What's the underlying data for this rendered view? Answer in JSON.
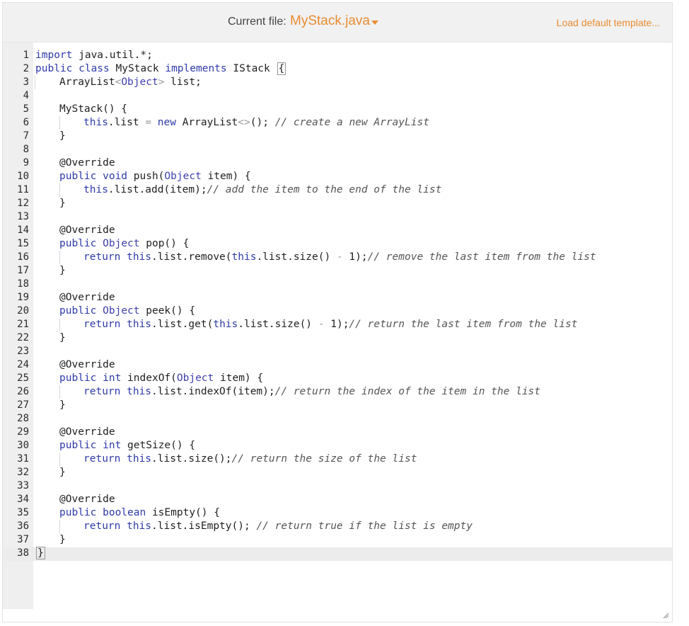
{
  "header": {
    "current_file_label": "Current file:",
    "file_name": "MyStack.java",
    "load_template": "Load default template..."
  },
  "editor": {
    "lines": [
      {
        "n": "1",
        "indent": 0,
        "segs": [
          [
            "kw",
            "import"
          ],
          [
            "",
            "java.util.*;"
          ]
        ]
      },
      {
        "n": "2",
        "indent": 0,
        "segs": [
          [
            "kw",
            "public class"
          ],
          [
            "",
            " MyStack "
          ],
          [
            "kw",
            "implements"
          ],
          [
            "",
            " IStack "
          ],
          [
            "br",
            "{"
          ]
        ]
      },
      {
        "n": "3",
        "indent": 1,
        "segs": [
          [
            "",
            "ArrayList"
          ],
          [
            "op",
            "<"
          ],
          [
            "ty",
            "Object"
          ],
          [
            "op",
            ">"
          ],
          [
            "",
            " list;"
          ]
        ]
      },
      {
        "n": "4",
        "indent": 0,
        "segs": []
      },
      {
        "n": "5",
        "indent": 1,
        "segs": [
          [
            "",
            "MyStack() {"
          ]
        ]
      },
      {
        "n": "6",
        "indent": 2,
        "segs": [
          [
            "kw",
            "this"
          ],
          [
            "",
            ".list "
          ],
          [
            "op",
            "="
          ],
          [
            "",
            " "
          ],
          [
            "kw",
            "new"
          ],
          [
            "",
            " ArrayList"
          ],
          [
            "op",
            "<>"
          ],
          [
            "",
            "(); "
          ],
          [
            "cm",
            "// create a new ArrayList"
          ]
        ]
      },
      {
        "n": "7",
        "indent": 1,
        "segs": [
          [
            "",
            "}"
          ]
        ]
      },
      {
        "n": "8",
        "indent": 0,
        "segs": []
      },
      {
        "n": "9",
        "indent": 1,
        "segs": [
          [
            "an",
            "@Override"
          ]
        ]
      },
      {
        "n": "10",
        "indent": 1,
        "segs": [
          [
            "kw",
            "public void"
          ],
          [
            "",
            " push("
          ],
          [
            "ty",
            "Object"
          ],
          [
            "",
            " item) {"
          ]
        ]
      },
      {
        "n": "11",
        "indent": 2,
        "segs": [
          [
            "kw",
            "this"
          ],
          [
            "",
            ".list.add(item);"
          ],
          [
            "cm",
            "// add the item to the end of the list"
          ]
        ]
      },
      {
        "n": "12",
        "indent": 1,
        "segs": [
          [
            "",
            "}"
          ]
        ]
      },
      {
        "n": "13",
        "indent": 0,
        "segs": []
      },
      {
        "n": "14",
        "indent": 1,
        "segs": [
          [
            "an",
            "@Override"
          ]
        ]
      },
      {
        "n": "15",
        "indent": 1,
        "segs": [
          [
            "kw",
            "public"
          ],
          [
            "",
            " "
          ],
          [
            "ty",
            "Object"
          ],
          [
            "",
            " pop() {"
          ]
        ]
      },
      {
        "n": "16",
        "indent": 2,
        "segs": [
          [
            "kw",
            "return this"
          ],
          [
            "",
            ".list.remove("
          ],
          [
            "kw",
            "this"
          ],
          [
            "",
            ".list.size() "
          ],
          [
            "op",
            "-"
          ],
          [
            "",
            " 1);"
          ],
          [
            "cm",
            "// remove the last item from the list"
          ]
        ]
      },
      {
        "n": "17",
        "indent": 1,
        "segs": [
          [
            "",
            "}"
          ]
        ]
      },
      {
        "n": "18",
        "indent": 0,
        "segs": []
      },
      {
        "n": "19",
        "indent": 1,
        "segs": [
          [
            "an",
            "@Override"
          ]
        ]
      },
      {
        "n": "20",
        "indent": 1,
        "segs": [
          [
            "kw",
            "public"
          ],
          [
            "",
            " "
          ],
          [
            "ty",
            "Object"
          ],
          [
            "",
            " peek() {"
          ]
        ]
      },
      {
        "n": "21",
        "indent": 2,
        "segs": [
          [
            "kw",
            "return this"
          ],
          [
            "",
            ".list.get("
          ],
          [
            "kw",
            "this"
          ],
          [
            "",
            ".list.size() "
          ],
          [
            "op",
            "-"
          ],
          [
            "",
            " 1);"
          ],
          [
            "cm",
            "// return the last item from the list"
          ]
        ]
      },
      {
        "n": "22",
        "indent": 1,
        "segs": [
          [
            "",
            "}"
          ]
        ]
      },
      {
        "n": "23",
        "indent": 0,
        "segs": []
      },
      {
        "n": "24",
        "indent": 1,
        "segs": [
          [
            "an",
            "@Override"
          ]
        ]
      },
      {
        "n": "25",
        "indent": 1,
        "segs": [
          [
            "kw",
            "public int"
          ],
          [
            "",
            " indexOf("
          ],
          [
            "ty",
            "Object"
          ],
          [
            "",
            " item) {"
          ]
        ]
      },
      {
        "n": "26",
        "indent": 2,
        "segs": [
          [
            "kw",
            "return this"
          ],
          [
            "",
            ".list.indexOf(item);"
          ],
          [
            "cm",
            "// return the index of the item in the list"
          ]
        ]
      },
      {
        "n": "27",
        "indent": 1,
        "segs": [
          [
            "",
            "}"
          ]
        ]
      },
      {
        "n": "28",
        "indent": 0,
        "segs": []
      },
      {
        "n": "29",
        "indent": 1,
        "segs": [
          [
            "an",
            "@Override"
          ]
        ]
      },
      {
        "n": "30",
        "indent": 1,
        "segs": [
          [
            "kw",
            "public int"
          ],
          [
            "",
            " getSize() {"
          ]
        ]
      },
      {
        "n": "31",
        "indent": 2,
        "segs": [
          [
            "kw",
            "return this"
          ],
          [
            "",
            ".list.size();"
          ],
          [
            "cm",
            "// return the size of the list"
          ]
        ]
      },
      {
        "n": "32",
        "indent": 1,
        "segs": [
          [
            "",
            "}"
          ]
        ]
      },
      {
        "n": "33",
        "indent": 0,
        "segs": []
      },
      {
        "n": "34",
        "indent": 1,
        "segs": [
          [
            "an",
            "@Override"
          ]
        ]
      },
      {
        "n": "35",
        "indent": 1,
        "segs": [
          [
            "kw",
            "public boolean"
          ],
          [
            "",
            " isEmpty() {"
          ]
        ]
      },
      {
        "n": "36",
        "indent": 2,
        "segs": [
          [
            "kw",
            "return this"
          ],
          [
            "",
            ".list.isEmpty(); "
          ],
          [
            "cm",
            "// return true if the list is empty"
          ]
        ]
      },
      {
        "n": "37",
        "indent": 1,
        "segs": [
          [
            "",
            "}"
          ]
        ]
      },
      {
        "n": "38",
        "indent": 0,
        "segs": [
          [
            "br",
            "}"
          ]
        ]
      }
    ]
  },
  "colors": {
    "accent": "#e98c32",
    "keyword": "#2e3aa8",
    "gutter": "#efefef"
  }
}
